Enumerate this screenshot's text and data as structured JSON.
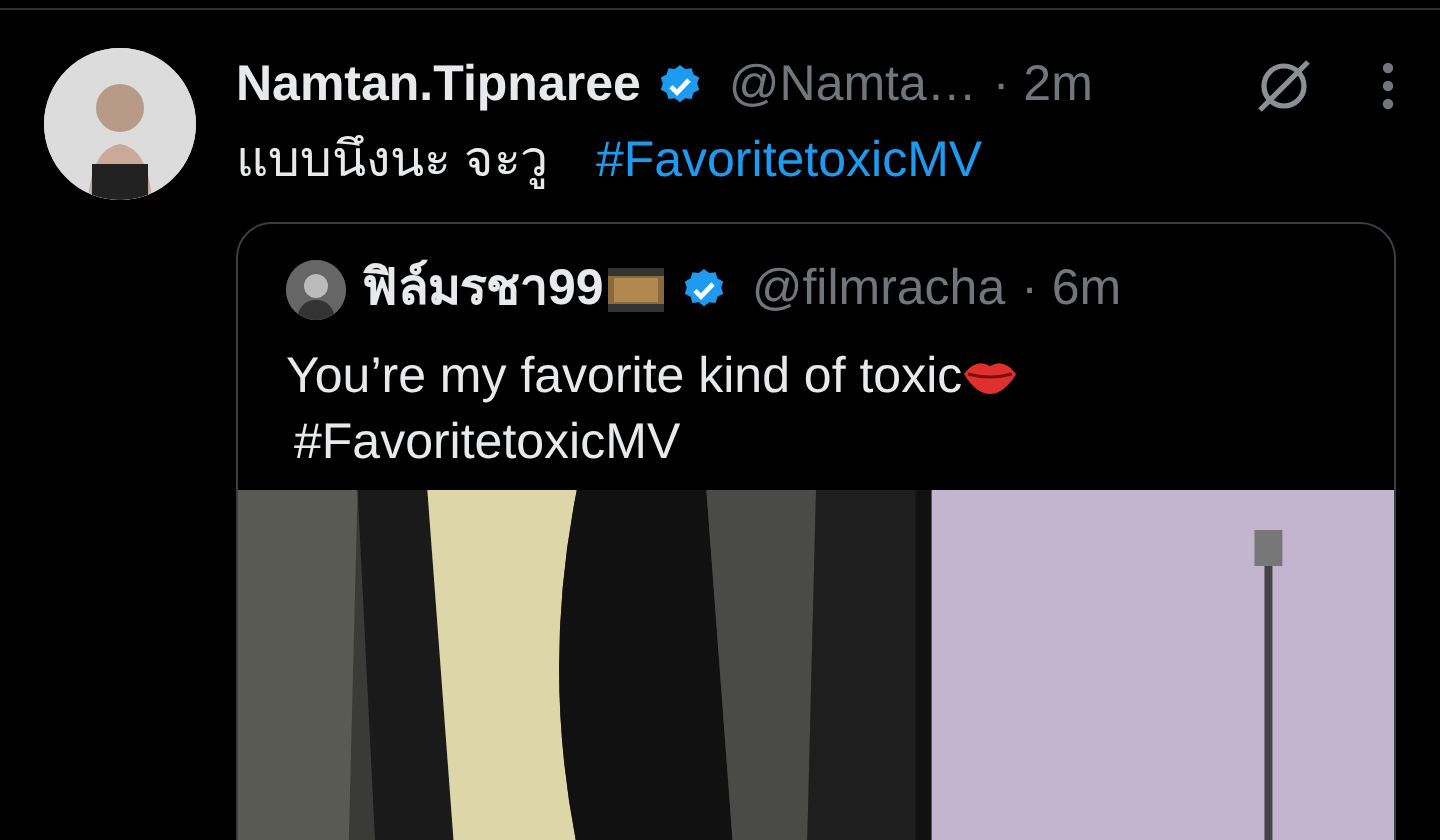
{
  "post": {
    "author": {
      "name": "Namtan.Tipnaree",
      "verified": true,
      "handle": "@Namta…",
      "time": "· 2m"
    },
    "text": "แบบนึงนะ จะวู",
    "hashtag": "#FavoritetoxicMV",
    "quote": {
      "author": {
        "name": "ฟิล์มรชา99",
        "verified": true,
        "handle": "@filmracha",
        "time": "· 6m"
      },
      "text": "You’re my favorite kind of toxic",
      "hashtag": "#FavoritetoxicMV"
    }
  }
}
